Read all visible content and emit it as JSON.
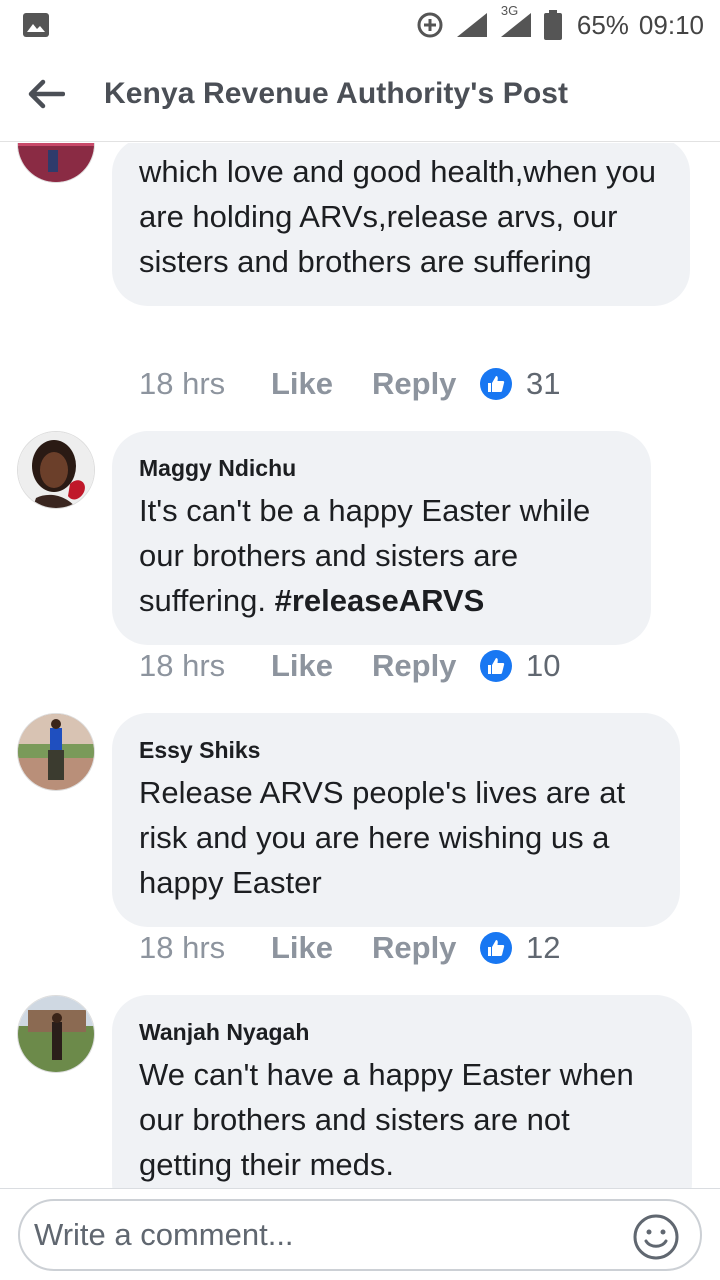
{
  "status_bar": {
    "network": "3G",
    "battery": "65%",
    "time": "09:10",
    "icons": [
      "gallery-icon",
      "data-saver-icon",
      "signal-icon",
      "signal-3g-icon",
      "battery-icon"
    ]
  },
  "header": {
    "back_icon": "back-arrow-icon",
    "title": "Kenya Revenue Authority's Post"
  },
  "comments": [
    {
      "author": "",
      "text": "which love and good health,when you are holding ARVs,release  arvs, our sisters and brothers are suffering",
      "time": "18 hrs",
      "like_label": "Like",
      "reply_label": "Reply",
      "likes": "31"
    },
    {
      "author": "Maggy Ndichu",
      "text": "It's can't be a happy Easter while our brothers and sisters are suffering. ",
      "hashtag": "#releaseARVS",
      "time": "18 hrs",
      "like_label": "Like",
      "reply_label": "Reply",
      "likes": "10"
    },
    {
      "author": "Essy Shiks",
      "text": "Release ARVS people's lives are at risk and you are here wishing us a happy Easter",
      "time": "18 hrs",
      "like_label": "Like",
      "reply_label": "Reply",
      "likes": "12"
    },
    {
      "author": "Wanjah Nyagah",
      "text": "We can't have a happy Easter when our brothers and sisters are not getting their meds.",
      "time": "",
      "like_label": "",
      "reply_label": "",
      "likes": ""
    }
  ],
  "composer": {
    "placeholder": "Write a comment...",
    "emoji_icon": "emoji-icon"
  },
  "colors": {
    "bubble": "#f0f2f5",
    "like_blue": "#1877f2",
    "muted": "#8d949e"
  }
}
